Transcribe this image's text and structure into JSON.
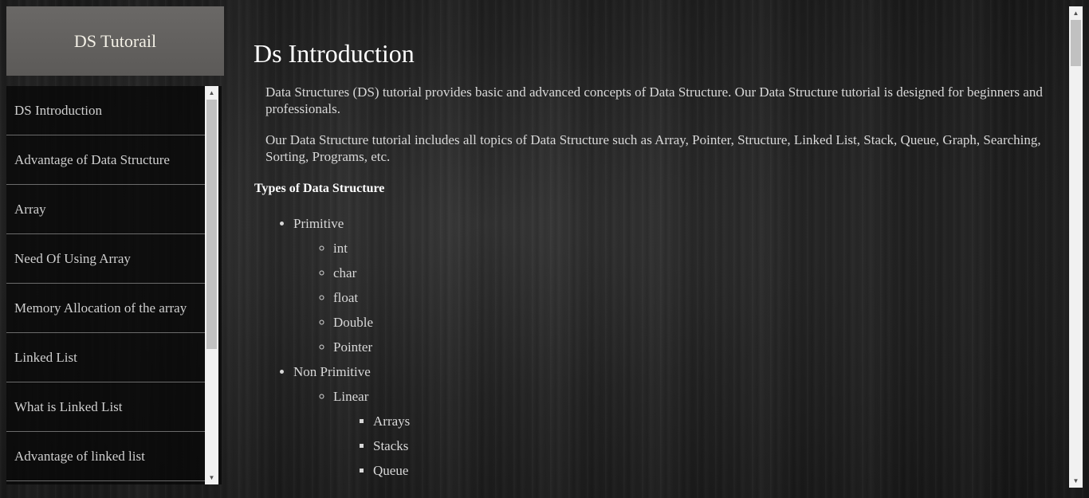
{
  "brand": {
    "title": "DS Tutorail"
  },
  "sidebar": {
    "items": [
      {
        "label": "DS Introduction"
      },
      {
        "label": "Advantage of Data Structure"
      },
      {
        "label": "Array"
      },
      {
        "label": "Need Of Using Array"
      },
      {
        "label": "Memory Allocation of the array"
      },
      {
        "label": "Linked List"
      },
      {
        "label": "What is Linked List"
      },
      {
        "label": "Advantage of linked list"
      }
    ]
  },
  "main": {
    "title": "Ds Introduction",
    "paragraphs": [
      "Data Structures (DS) tutorial provides basic and advanced concepts of Data Structure. Our Data Structure tutorial is designed for beginners and professionals.",
      "Our Data Structure tutorial includes all topics of Data Structure such as Array, Pointer, Structure, Linked List, Stack, Queue, Graph, Searching, Sorting, Programs, etc."
    ],
    "section_title": "Types of Data Structure",
    "types": {
      "primitive": {
        "label": "Primitive",
        "items": [
          "int",
          "char",
          "float",
          "Double",
          "Pointer"
        ]
      },
      "non_primitive": {
        "label": "Non Primitive",
        "linear": {
          "label": "Linear",
          "items": [
            "Arrays",
            "Stacks",
            "Queue"
          ]
        }
      }
    }
  },
  "scrollbars": {
    "up_icon": "▲",
    "down_icon": "▼"
  },
  "colors": {
    "brand_bg": "#5f5d5b",
    "sidebar_bg": "#0a0a0a",
    "text": "#d8d8d8"
  }
}
